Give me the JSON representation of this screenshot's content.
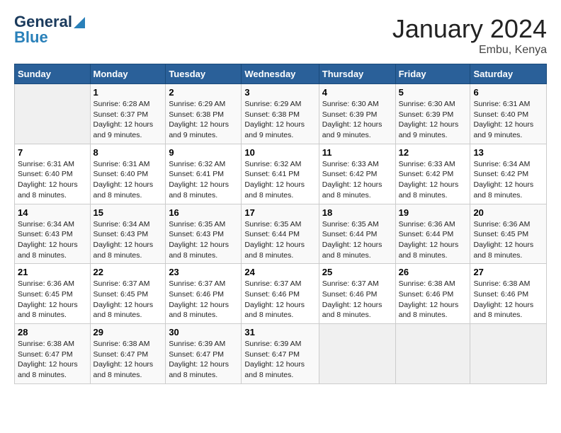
{
  "header": {
    "logo_line1": "General",
    "logo_line2": "Blue",
    "month": "January 2024",
    "location": "Embu, Kenya"
  },
  "weekdays": [
    "Sunday",
    "Monday",
    "Tuesday",
    "Wednesday",
    "Thursday",
    "Friday",
    "Saturday"
  ],
  "weeks": [
    [
      {
        "day": "",
        "sunrise": "",
        "sunset": "",
        "daylight": ""
      },
      {
        "day": "1",
        "sunrise": "Sunrise: 6:28 AM",
        "sunset": "Sunset: 6:37 PM",
        "daylight": "Daylight: 12 hours and 9 minutes."
      },
      {
        "day": "2",
        "sunrise": "Sunrise: 6:29 AM",
        "sunset": "Sunset: 6:38 PM",
        "daylight": "Daylight: 12 hours and 9 minutes."
      },
      {
        "day": "3",
        "sunrise": "Sunrise: 6:29 AM",
        "sunset": "Sunset: 6:38 PM",
        "daylight": "Daylight: 12 hours and 9 minutes."
      },
      {
        "day": "4",
        "sunrise": "Sunrise: 6:30 AM",
        "sunset": "Sunset: 6:39 PM",
        "daylight": "Daylight: 12 hours and 9 minutes."
      },
      {
        "day": "5",
        "sunrise": "Sunrise: 6:30 AM",
        "sunset": "Sunset: 6:39 PM",
        "daylight": "Daylight: 12 hours and 9 minutes."
      },
      {
        "day": "6",
        "sunrise": "Sunrise: 6:31 AM",
        "sunset": "Sunset: 6:40 PM",
        "daylight": "Daylight: 12 hours and 9 minutes."
      }
    ],
    [
      {
        "day": "7",
        "sunrise": "Sunrise: 6:31 AM",
        "sunset": "Sunset: 6:40 PM",
        "daylight": "Daylight: 12 hours and 8 minutes."
      },
      {
        "day": "8",
        "sunrise": "Sunrise: 6:31 AM",
        "sunset": "Sunset: 6:40 PM",
        "daylight": "Daylight: 12 hours and 8 minutes."
      },
      {
        "day": "9",
        "sunrise": "Sunrise: 6:32 AM",
        "sunset": "Sunset: 6:41 PM",
        "daylight": "Daylight: 12 hours and 8 minutes."
      },
      {
        "day": "10",
        "sunrise": "Sunrise: 6:32 AM",
        "sunset": "Sunset: 6:41 PM",
        "daylight": "Daylight: 12 hours and 8 minutes."
      },
      {
        "day": "11",
        "sunrise": "Sunrise: 6:33 AM",
        "sunset": "Sunset: 6:42 PM",
        "daylight": "Daylight: 12 hours and 8 minutes."
      },
      {
        "day": "12",
        "sunrise": "Sunrise: 6:33 AM",
        "sunset": "Sunset: 6:42 PM",
        "daylight": "Daylight: 12 hours and 8 minutes."
      },
      {
        "day": "13",
        "sunrise": "Sunrise: 6:34 AM",
        "sunset": "Sunset: 6:42 PM",
        "daylight": "Daylight: 12 hours and 8 minutes."
      }
    ],
    [
      {
        "day": "14",
        "sunrise": "Sunrise: 6:34 AM",
        "sunset": "Sunset: 6:43 PM",
        "daylight": "Daylight: 12 hours and 8 minutes."
      },
      {
        "day": "15",
        "sunrise": "Sunrise: 6:34 AM",
        "sunset": "Sunset: 6:43 PM",
        "daylight": "Daylight: 12 hours and 8 minutes."
      },
      {
        "day": "16",
        "sunrise": "Sunrise: 6:35 AM",
        "sunset": "Sunset: 6:43 PM",
        "daylight": "Daylight: 12 hours and 8 minutes."
      },
      {
        "day": "17",
        "sunrise": "Sunrise: 6:35 AM",
        "sunset": "Sunset: 6:44 PM",
        "daylight": "Daylight: 12 hours and 8 minutes."
      },
      {
        "day": "18",
        "sunrise": "Sunrise: 6:35 AM",
        "sunset": "Sunset: 6:44 PM",
        "daylight": "Daylight: 12 hours and 8 minutes."
      },
      {
        "day": "19",
        "sunrise": "Sunrise: 6:36 AM",
        "sunset": "Sunset: 6:44 PM",
        "daylight": "Daylight: 12 hours and 8 minutes."
      },
      {
        "day": "20",
        "sunrise": "Sunrise: 6:36 AM",
        "sunset": "Sunset: 6:45 PM",
        "daylight": "Daylight: 12 hours and 8 minutes."
      }
    ],
    [
      {
        "day": "21",
        "sunrise": "Sunrise: 6:36 AM",
        "sunset": "Sunset: 6:45 PM",
        "daylight": "Daylight: 12 hours and 8 minutes."
      },
      {
        "day": "22",
        "sunrise": "Sunrise: 6:37 AM",
        "sunset": "Sunset: 6:45 PM",
        "daylight": "Daylight: 12 hours and 8 minutes."
      },
      {
        "day": "23",
        "sunrise": "Sunrise: 6:37 AM",
        "sunset": "Sunset: 6:46 PM",
        "daylight": "Daylight: 12 hours and 8 minutes."
      },
      {
        "day": "24",
        "sunrise": "Sunrise: 6:37 AM",
        "sunset": "Sunset: 6:46 PM",
        "daylight": "Daylight: 12 hours and 8 minutes."
      },
      {
        "day": "25",
        "sunrise": "Sunrise: 6:37 AM",
        "sunset": "Sunset: 6:46 PM",
        "daylight": "Daylight: 12 hours and 8 minutes."
      },
      {
        "day": "26",
        "sunrise": "Sunrise: 6:38 AM",
        "sunset": "Sunset: 6:46 PM",
        "daylight": "Daylight: 12 hours and 8 minutes."
      },
      {
        "day": "27",
        "sunrise": "Sunrise: 6:38 AM",
        "sunset": "Sunset: 6:46 PM",
        "daylight": "Daylight: 12 hours and 8 minutes."
      }
    ],
    [
      {
        "day": "28",
        "sunrise": "Sunrise: 6:38 AM",
        "sunset": "Sunset: 6:47 PM",
        "daylight": "Daylight: 12 hours and 8 minutes."
      },
      {
        "day": "29",
        "sunrise": "Sunrise: 6:38 AM",
        "sunset": "Sunset: 6:47 PM",
        "daylight": "Daylight: 12 hours and 8 minutes."
      },
      {
        "day": "30",
        "sunrise": "Sunrise: 6:39 AM",
        "sunset": "Sunset: 6:47 PM",
        "daylight": "Daylight: 12 hours and 8 minutes."
      },
      {
        "day": "31",
        "sunrise": "Sunrise: 6:39 AM",
        "sunset": "Sunset: 6:47 PM",
        "daylight": "Daylight: 12 hours and 8 minutes."
      },
      {
        "day": "",
        "sunrise": "",
        "sunset": "",
        "daylight": ""
      },
      {
        "day": "",
        "sunrise": "",
        "sunset": "",
        "daylight": ""
      },
      {
        "day": "",
        "sunrise": "",
        "sunset": "",
        "daylight": ""
      }
    ]
  ]
}
